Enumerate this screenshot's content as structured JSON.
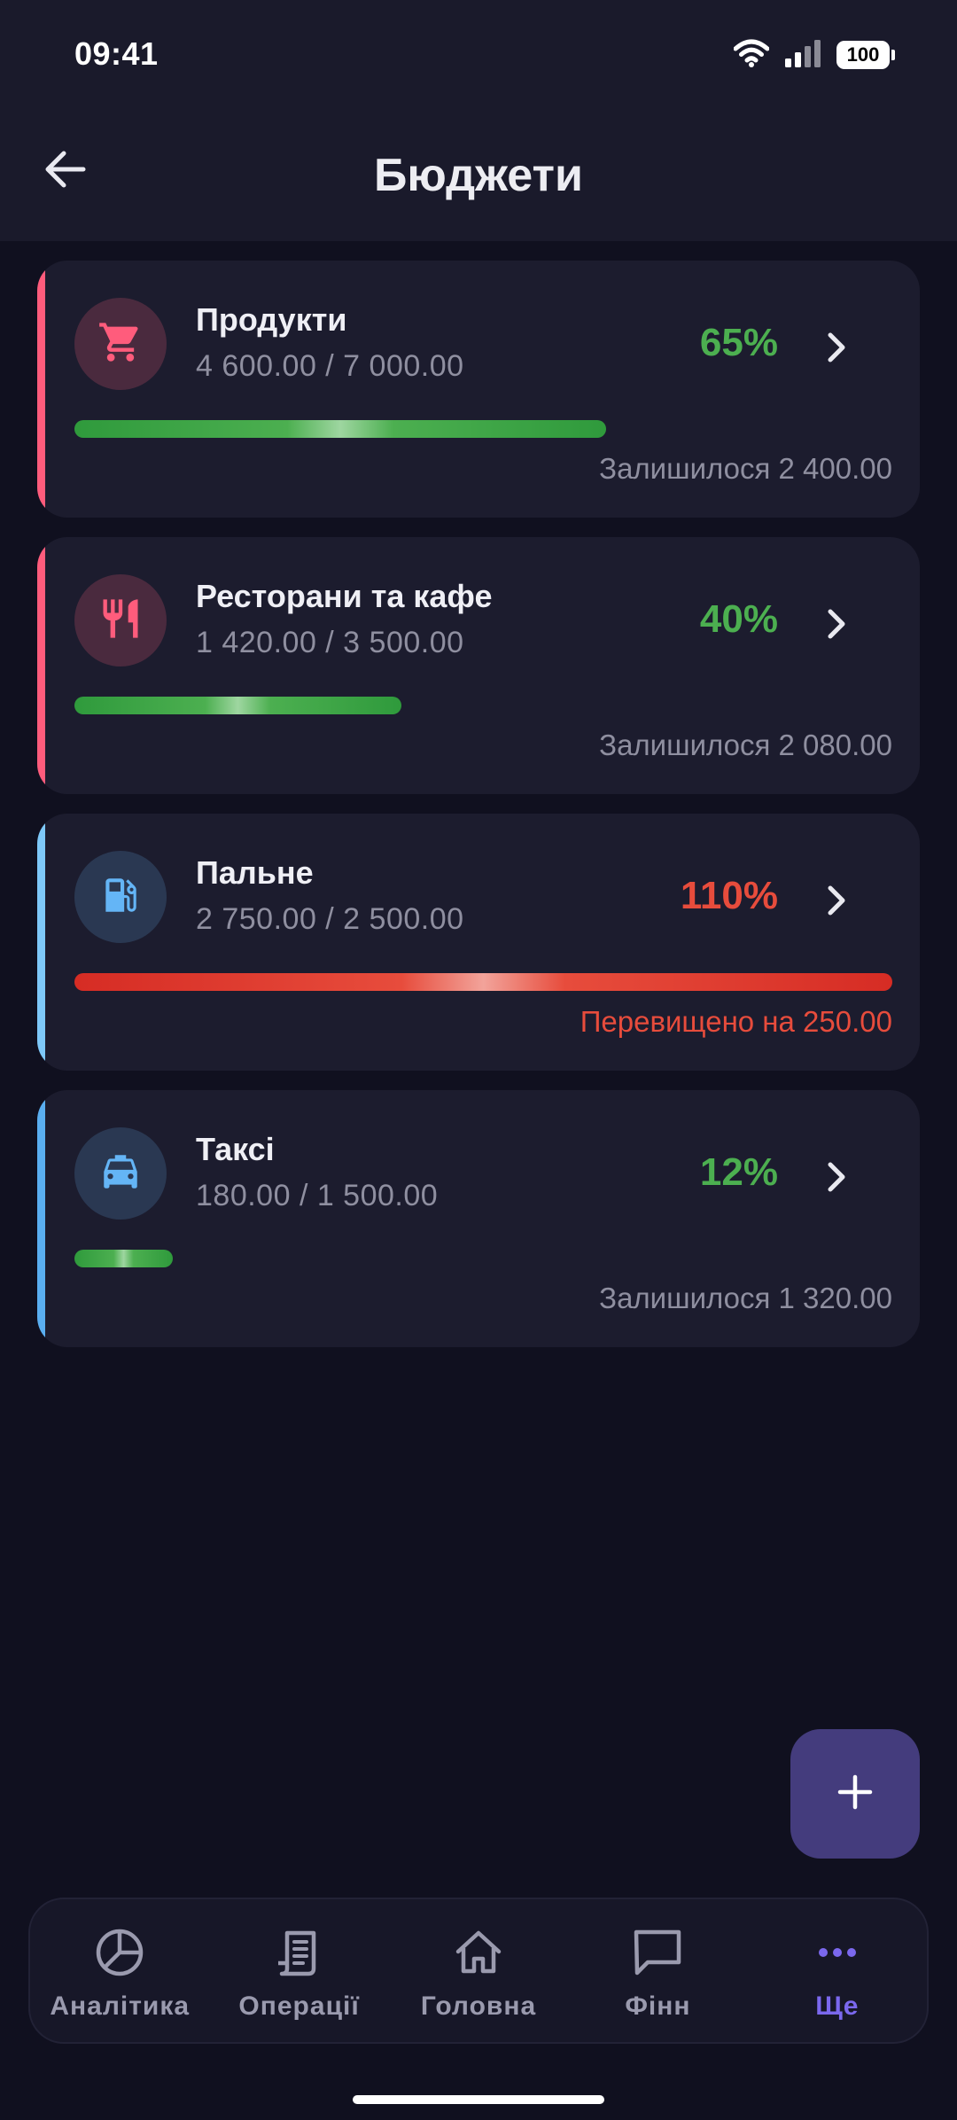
{
  "status_bar": {
    "time": "09:41",
    "battery": "100"
  },
  "header": {
    "title": "Бюджети",
    "back_icon": "arrow-left-icon"
  },
  "colors": {
    "green": "#4caf50",
    "red": "#e74c3c",
    "accent_pink": "#ff5c7c",
    "accent_blue": "#64b5f6",
    "active_nav": "#7b68ee"
  },
  "budgets": [
    {
      "name": "Продукти",
      "amount": "4 600.00 / 7 000.00",
      "percent": "65%",
      "progress": 0.65,
      "status": "ok",
      "note": "Залишилося 2 400.00",
      "icon": "cart-icon",
      "accent": "#ff5c7c",
      "icon_bg": "#4a2a3e",
      "icon_color": "#ff5c7c"
    },
    {
      "name": "Ресторани та кафе",
      "amount": "1 420.00 / 3 500.00",
      "percent": "40%",
      "progress": 0.4,
      "status": "ok",
      "note": "Залишилося 2 080.00",
      "icon": "restaurant-icon",
      "accent": "#ff5c7c",
      "icon_bg": "#4a2a3e",
      "icon_color": "#ff5c7c"
    },
    {
      "name": "Пальне",
      "amount": "2 750.00 / 2 500.00",
      "percent": "110%",
      "progress": 1.0,
      "status": "over",
      "note": "Перевищено на 250.00",
      "icon": "fuel-icon",
      "accent": "#7ec8f8",
      "icon_bg": "#2a3852",
      "icon_color": "#64b5f6"
    },
    {
      "name": "Таксі",
      "amount": "180.00 / 1 500.00",
      "percent": "12%",
      "progress": 0.12,
      "status": "ok",
      "note": "Залишилося 1 320.00",
      "icon": "taxi-icon",
      "accent": "#5aaef0",
      "icon_bg": "#2a3852",
      "icon_color": "#64b5f6"
    }
  ],
  "fab": {
    "icon": "plus-icon"
  },
  "nav": [
    {
      "label": "Аналітика",
      "icon": "pie-chart-icon",
      "active": false
    },
    {
      "label": "Операції",
      "icon": "receipt-icon",
      "active": false
    },
    {
      "label": "Головна",
      "icon": "home-icon",
      "active": false
    },
    {
      "label": "Фінн",
      "icon": "chat-icon",
      "active": false
    },
    {
      "label": "Ще",
      "icon": "more-icon",
      "active": true
    }
  ]
}
